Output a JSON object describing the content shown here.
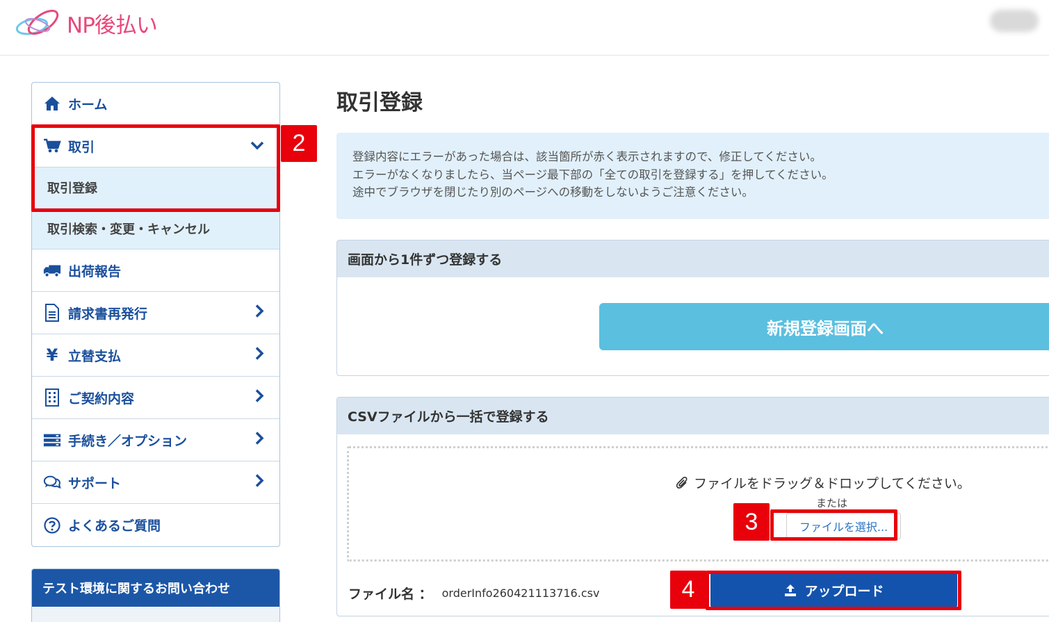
{
  "header": {
    "logo_text": "NP後払い"
  },
  "sidebar": {
    "items": [
      {
        "label": "ホーム",
        "icon": "home-icon"
      },
      {
        "label": "取引",
        "icon": "cart-icon"
      },
      {
        "label": "出荷報告",
        "icon": "truck-icon"
      },
      {
        "label": "請求書再発行",
        "icon": "document-icon"
      },
      {
        "label": "立替支払",
        "icon": "yen-icon"
      },
      {
        "label": "ご契約内容",
        "icon": "building-icon"
      },
      {
        "label": "手続き／オプション",
        "icon": "server-icon"
      },
      {
        "label": "サポート",
        "icon": "chat-icon"
      },
      {
        "label": "よくあるご質問",
        "icon": "question-icon"
      }
    ],
    "sub_items": [
      {
        "label": "取引登録"
      },
      {
        "label": "取引検索・変更・キャンセル"
      }
    ],
    "contact_title": "テスト環境に関するお問い合わせ"
  },
  "annotations": {
    "badge_2": "2",
    "badge_3": "3",
    "badge_4": "4",
    "color": "#e8000b"
  },
  "main": {
    "title": "取引登録",
    "alert_lines": [
      "登録内容にエラーがあった場合は、該当箇所が赤く表示されますので、修正してください。",
      "エラーがなくなりましたら、当ページ最下部の「全ての取引を登録する」を押してください。",
      "途中でブラウザを閉じたり別のページへの移動をしないようご注意ください。"
    ],
    "panel_single": {
      "title": "画面から1件ずつ登録する",
      "button": "新規登録画面へ"
    },
    "panel_csv": {
      "title": "CSVファイルから一括で登録する",
      "drop_text": "ファイルをドラッグ＆ドロップしてください。",
      "or_text": "または",
      "select_button": "ファイルを選択...",
      "filename_label": "ファイル名 ：",
      "filename_value": "orderInfo260421113716.csv",
      "upload_button": "アップロード"
    }
  },
  "colors": {
    "brand_pink": "#e8497a",
    "nav_blue": "#1a4f9c",
    "upload_blue": "#1453ad",
    "new_button": "#5bbfe0",
    "alert_bg": "#e1f0fa"
  }
}
